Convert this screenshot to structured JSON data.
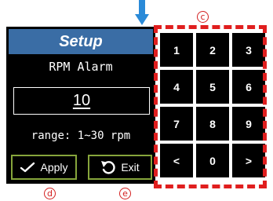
{
  "annotations": {
    "keypad": "c",
    "apply": "d",
    "exit": "e"
  },
  "screen": {
    "title": "Setup",
    "alarm_label": "RPM Alarm",
    "value": "10",
    "range_text": "range: 1~30 rpm",
    "apply_label": "Apply",
    "exit_label": "Exit"
  },
  "keypad": {
    "keys": [
      "1",
      "2",
      "3",
      "4",
      "5",
      "6",
      "7",
      "8",
      "9",
      "<",
      "0",
      ">"
    ]
  },
  "colors": {
    "title_bar": "#3a6da5",
    "button_border": "#86a53b",
    "annotation": "#d31f1f",
    "arrow": "#2a8ad8"
  }
}
